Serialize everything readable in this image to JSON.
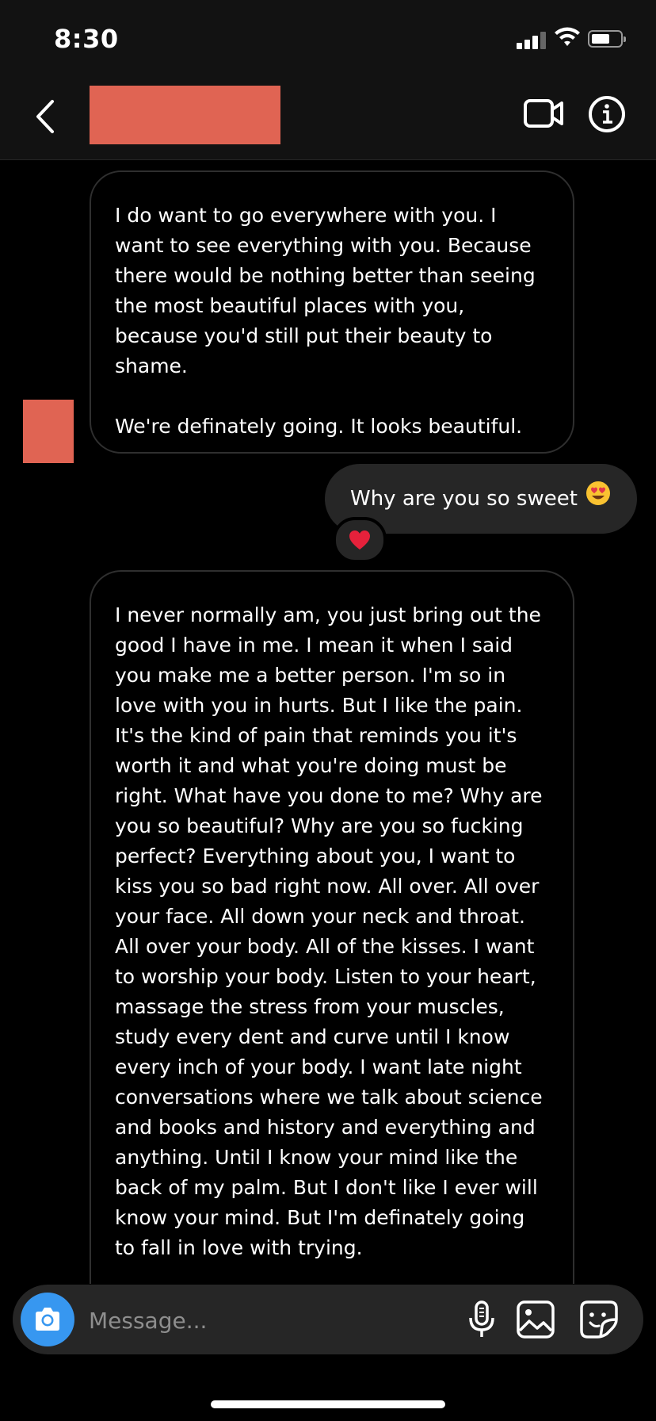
{
  "status_bar": {
    "time": "8:30"
  },
  "header": {
    "contact_name": ""
  },
  "messages": [
    {
      "direction": "incoming",
      "text": "I do want to go everywhere with you. I want to see everything with you. Because there would be nothing better than seeing the most beautiful places with you, because you'd still put their beauty to shame.\n\nWe're definately going. It looks beautiful."
    },
    {
      "direction": "outgoing",
      "text": "Why are you so sweet",
      "emoji": "😍",
      "reaction": "❤️"
    },
    {
      "direction": "incoming",
      "text": "I never normally am, you just bring out the good I have in me. I mean it when I said you make me a better person. I'm so in love with you in hurts. But I like the pain. It's the kind of pain that reminds you it's worth it and what you're doing must be right. What have you done to me? Why are you so beautiful? Why are you so fucking perfect? Everything about you, I want to kiss you so bad right now. All over. All over your face. All down your neck and throat. All over your body. All of the kisses. I want to worship your body. Listen to your heart, massage the stress from your muscles, study every dent and curve until I know every inch of your body. I want late night conversations where we talk about science and books and history and everything and anything. Until I know your mind like the back of my palm. But I don't like I ever will know your mind. But I'm definately going to fall in love with trying."
    }
  ],
  "composer": {
    "placeholder": "Message..."
  },
  "colors": {
    "accent": "#3797f0",
    "redaction": "#e06453",
    "bubble_out": "#262626",
    "background": "#000000"
  },
  "icons": [
    "back-chevron-icon",
    "video-call-icon",
    "info-icon",
    "camera-icon",
    "microphone-icon",
    "gallery-icon",
    "sticker-icon"
  ]
}
